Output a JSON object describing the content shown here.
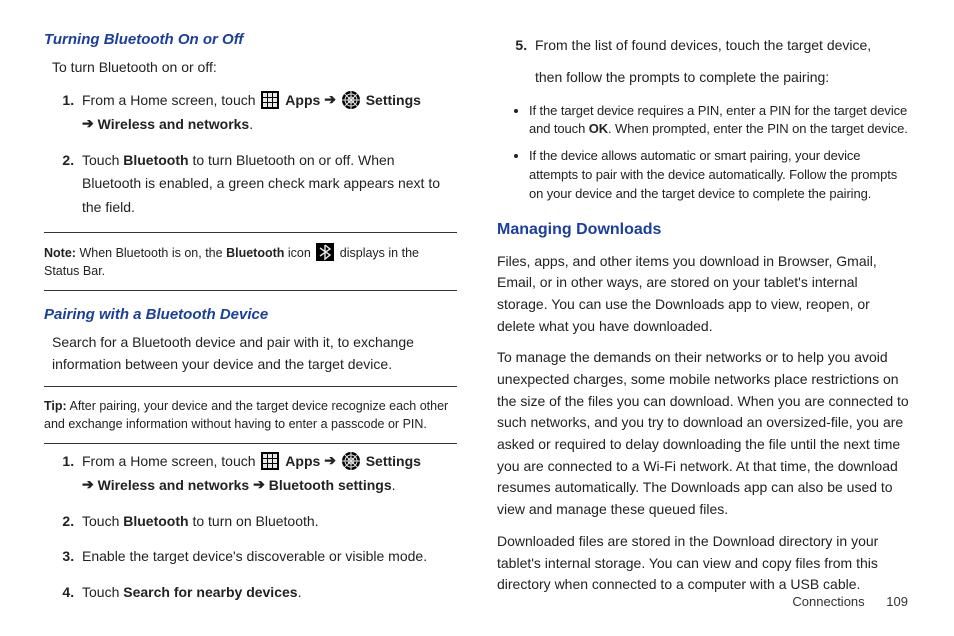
{
  "left": {
    "h1": "Turning Bluetooth On or Off",
    "intro": "To turn Bluetooth on or off:",
    "step1a": "From a Home screen, touch ",
    "apps": "Apps",
    "arrow": "➔",
    "settings": "Settings",
    "step1b": "Wireless and networks",
    "step1c": ".",
    "step2a": "Touch ",
    "step2b": "Bluetooth",
    "step2c": " to turn Bluetooth on or off. When Bluetooth is enabled, a green check mark appears next to the field.",
    "note_label": "Note:",
    "note_a": "When Bluetooth is on, the ",
    "note_b": "Bluetooth",
    "note_c": " icon ",
    "note_d": " displays in the Status Bar.",
    "h2": "Pairing with a Bluetooth Device",
    "pair_intro": "Search for a Bluetooth device and pair with it, to exchange information between your device and the target device.",
    "tip_label": "Tip:",
    "tip_body": "After pairing, your device and the target device recognize each other and exchange information without having to enter a passcode or PIN.",
    "pstep1a": "From a Home screen, touch ",
    "pstep1b": "Wireless and networks",
    "pstep1c": "Bluetooth settings",
    "pstep2a": "Touch ",
    "pstep2b": "Bluetooth",
    "pstep2c": " to turn on Bluetooth.",
    "pstep3": "Enable the target device's discoverable or visible mode.",
    "pstep4a": "Touch ",
    "pstep4b": "Search for nearby devices",
    "pstep4c": "."
  },
  "right": {
    "step5a": "From the list of found devices, touch the target device,",
    "step5b": "then follow the prompts to complete the pairing:",
    "bullet1a": "If the target device requires a PIN, enter a PIN for the target device and touch ",
    "bullet1b": "OK",
    "bullet1c": ". When prompted, enter the PIN on the target device.",
    "bullet2": "If the device allows automatic or smart pairing, your device attempts to pair with the device automatically. Follow the prompts on your device and the target device to complete the pairing.",
    "h3": "Managing Downloads",
    "p1": "Files, apps, and other items you download in Browser, Gmail, Email, or in other ways, are stored on your tablet's internal storage. You can use the Downloads app to view, reopen, or delete what you have downloaded.",
    "p2": "To manage the demands on their networks or to help you avoid unexpected charges, some mobile networks place restrictions on the size of the files you can download. When you are connected to such networks, and you try to download an oversized-file, you are asked or required to delay downloading the file until the next time you are connected to a Wi-Fi network. At that time, the download resumes automatically. The Downloads app can also be used to view and manage these queued files.",
    "p3": "Downloaded files are stored in the Download directory in your tablet's internal storage. You can view and copy files from this directory when connected to a computer with a USB cable."
  },
  "footer": {
    "section": "Connections",
    "page": "109"
  }
}
